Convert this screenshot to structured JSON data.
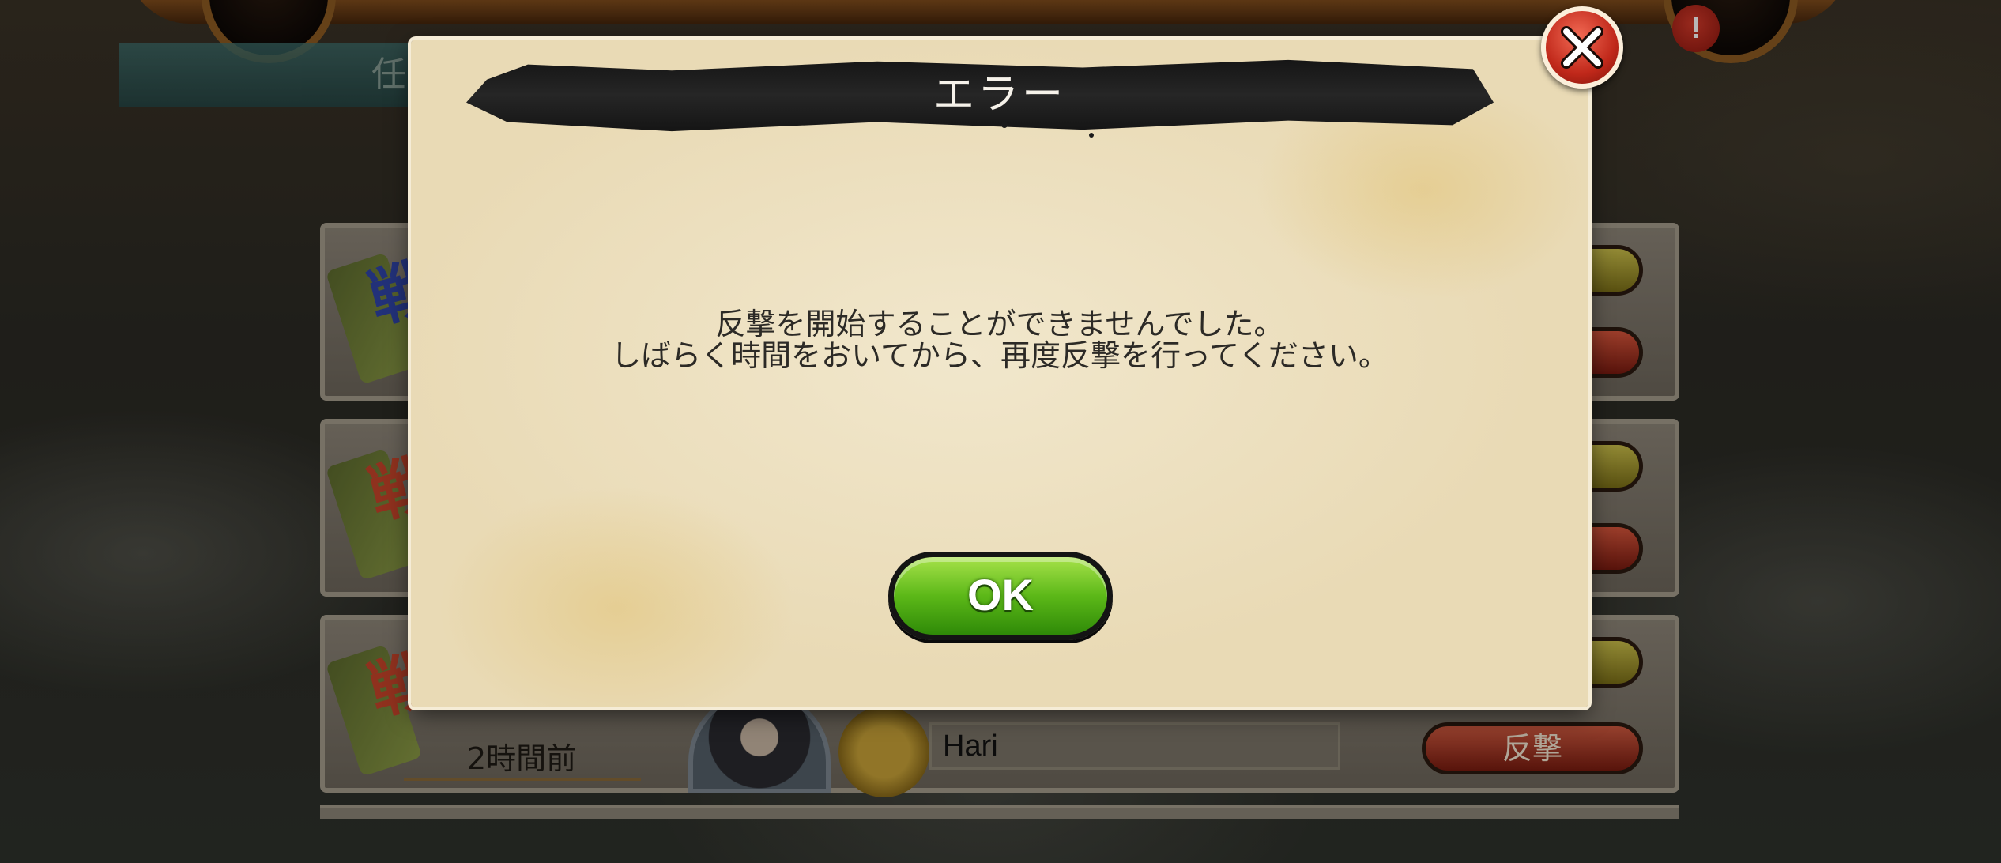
{
  "dialog": {
    "title": "エラー",
    "message_line1": "反撃を開始することができませんでした。",
    "message_line2": "しばらく時間をおいてから、再度反撃を行ってください。",
    "ok_label": "OK",
    "close_icon": "close-x-icon"
  },
  "background": {
    "tab_label": "任",
    "alert_badge": "!",
    "rows": [
      {
        "badge_icon": "battle-scroll-icon",
        "badge_glyph": "戦",
        "badge_color": "#3045a8"
      },
      {
        "badge_icon": "battle-scroll-icon",
        "badge_glyph": "戦",
        "badge_color": "#c7442a"
      },
      {
        "badge_icon": "battle-scroll-icon",
        "badge_glyph": "戦",
        "badge_color": "#c7442a",
        "time": "2時間前",
        "player_name": "Hari",
        "action_label": "反撃"
      }
    ]
  },
  "colors": {
    "ok_green": "#5cb818",
    "close_red": "#c0281a",
    "parchment": "#efe4c6",
    "title_band": "#1b1b1b"
  }
}
